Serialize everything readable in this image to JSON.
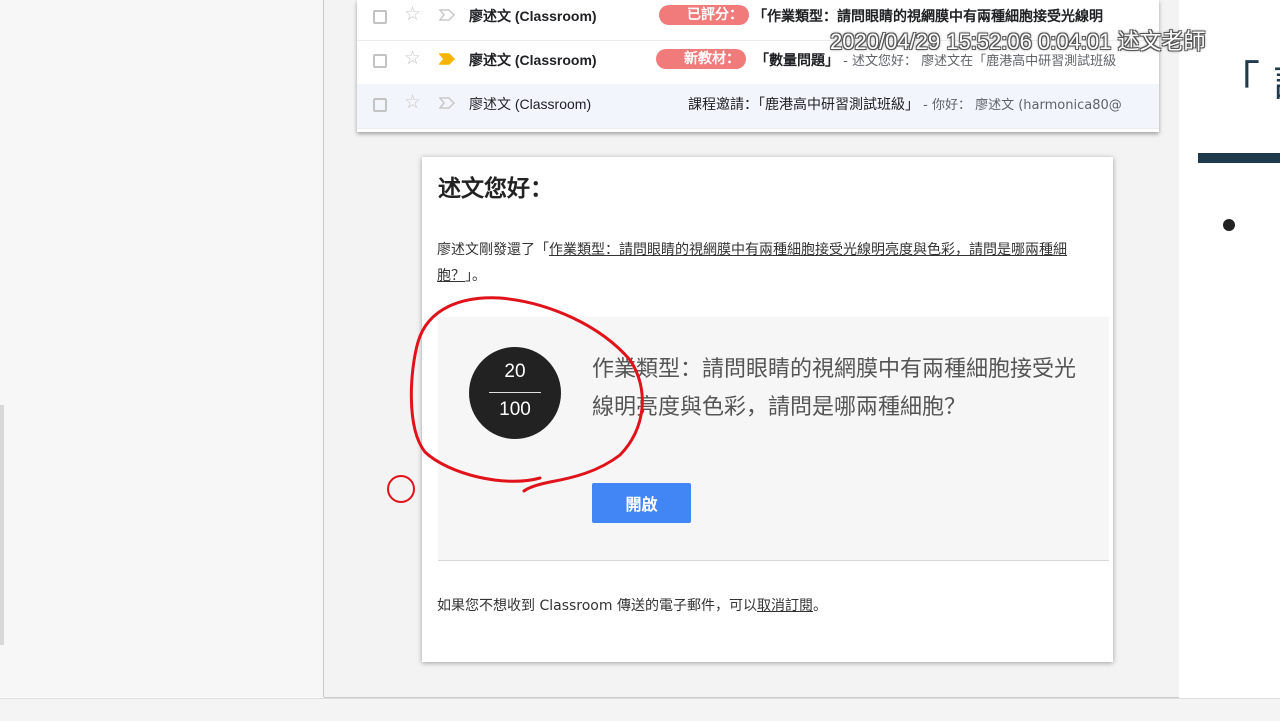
{
  "overlay": {
    "timestamp": "2020/04/29 15:52:06 0:04:01 述文老師"
  },
  "inbox": {
    "rows": [
      {
        "sender": "廖述文 (Classroom)",
        "badge": "已評分：",
        "subject": "「作業類型：請問眼睛的視網膜中有兩種細胞接受光線明",
        "snippet": ""
      },
      {
        "sender": "廖述文 (Classroom)",
        "badge": "新教材：",
        "subject": "「數量問題」",
        "snippet": " - 述文您好： 廖述文在「鹿港高中研習測試班級"
      },
      {
        "sender": "廖述文 (Classroom)",
        "badge": "",
        "subject": "課程邀請：「鹿港高中研習測試班級」",
        "snippet": " - 你好： 廖述文 (harmonica80@"
      }
    ]
  },
  "email": {
    "greeting": "述文您好：",
    "intro_prefix": "廖述文剛發還了「",
    "intro_link": "作業類型：請問眼睛的視網膜中有兩種細胞接受光線明亮度與色彩，請問是哪兩種細胞？",
    "intro_suffix": "」。",
    "score": {
      "earned": "20",
      "total": "100"
    },
    "assignment_title": "作業類型：請問眼睛的視網膜中有兩種細胞接受光線明亮度與色彩，請問是哪兩種細胞？",
    "open_button": "開啟",
    "footer_prefix": "如果您不想收到 Classroom 傳送的電子郵件，可以",
    "footer_link": "取消訂閱",
    "footer_suffix": "。"
  },
  "slide": {
    "title_fragment": "「 課"
  },
  "colors": {
    "badge": "#f17b7b",
    "button": "#4285f4",
    "annotation": "#e0131b",
    "score_circle": "#222222"
  }
}
